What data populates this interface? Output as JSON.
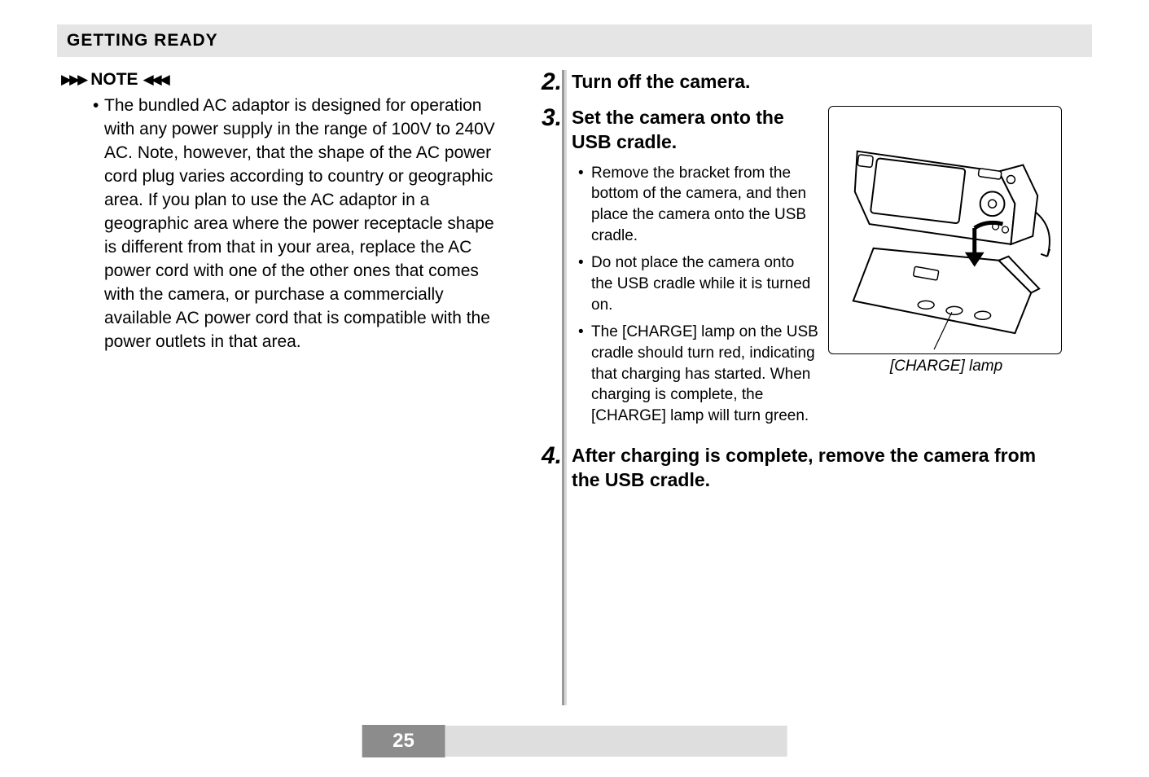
{
  "header": {
    "title": "GETTING READY"
  },
  "note": {
    "label": "NOTE",
    "bullet_marker": "•",
    "body": "The bundled AC adaptor is designed for operation with any power supply in the range of 100V to 240V AC. Note, however, that the shape of the AC power cord plug varies according to country or geographic area. If you plan to use the AC adaptor in a geographic area where the power receptacle shape is different from that in your area, replace the AC power cord with one of the other ones that comes with the camera, or purchase a commercially available AC power cord that is compatible with the power outlets in that area."
  },
  "steps": {
    "s2": {
      "num": "2.",
      "title": "Turn off the camera."
    },
    "s3": {
      "num": "3.",
      "title": "Set the camera onto the USB cradle.",
      "bullets": [
        "Remove the bracket from the bottom of the camera, and then place the camera onto the USB cradle.",
        "Do not place the camera onto the USB cradle while it is turned on.",
        "The [CHARGE] lamp on the USB cradle should turn red, indicating that charging has started. When charging is complete, the [CHARGE] lamp will turn green."
      ],
      "caption": "[CHARGE] lamp"
    },
    "s4": {
      "num": "4.",
      "title": "After charging is complete, remove the camera from the USB cradle."
    }
  },
  "page_number": "25"
}
